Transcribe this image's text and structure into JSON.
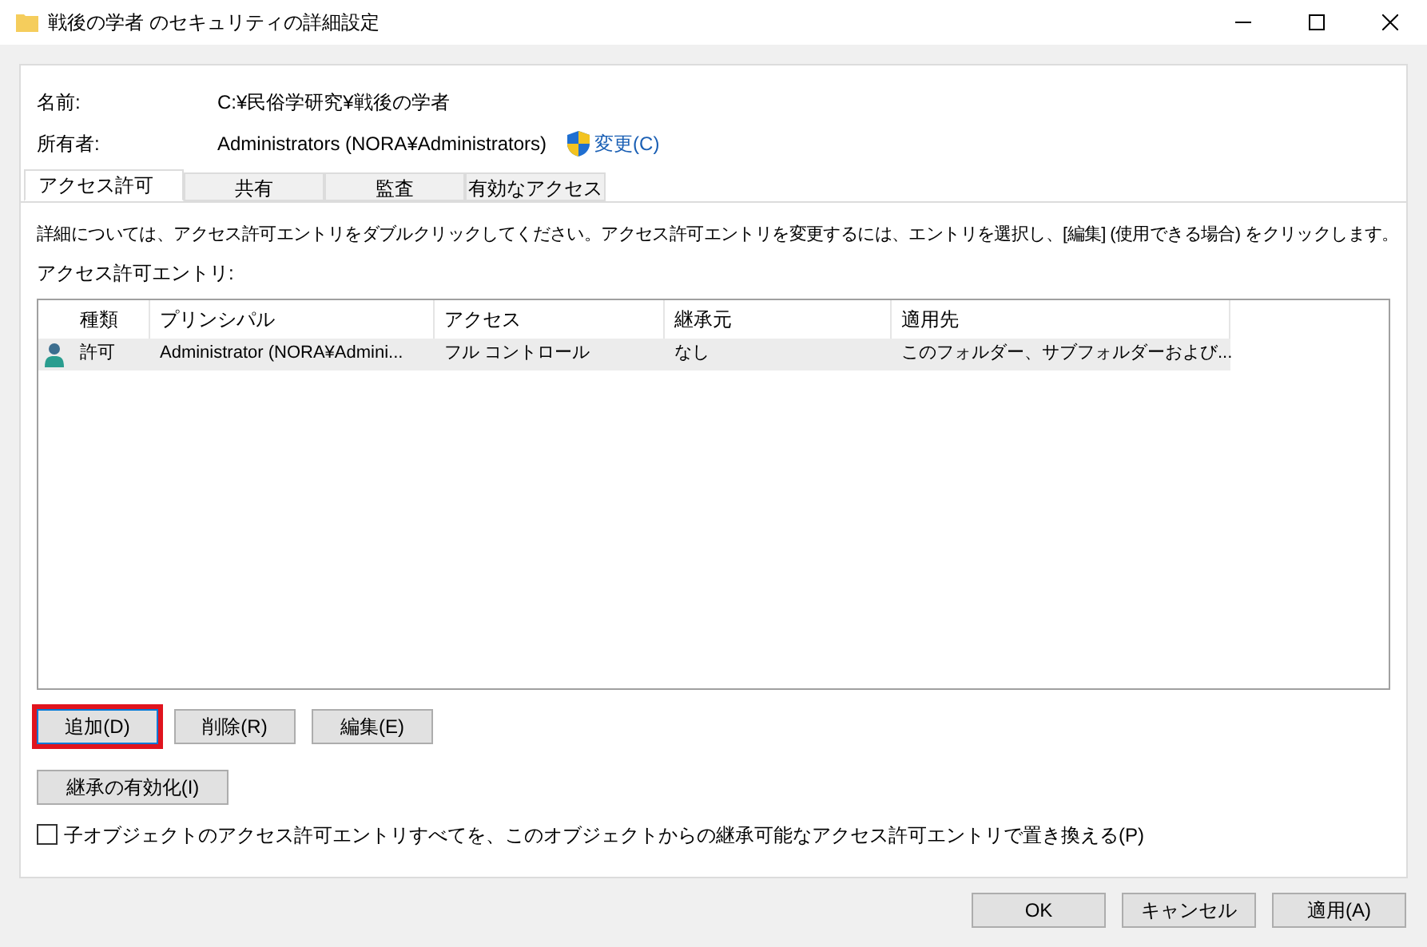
{
  "window": {
    "title": "戦後の学者 のセキュリティの詳細設定"
  },
  "fields": [
    {
      "label": "名前:",
      "value": "C:¥民俗学研究¥戦後の学者"
    },
    {
      "label": "所有者:",
      "value": "Administrators (NORA¥Administrators)",
      "link": "変更(C)"
    }
  ],
  "tabs": [
    {
      "label": "アクセス許可",
      "selected": true
    },
    {
      "label": "共有",
      "selected": false
    },
    {
      "label": "監査",
      "selected": false
    },
    {
      "label": "有効なアクセス",
      "selected": false
    }
  ],
  "info": "詳細については、アクセス許可エントリをダブルクリックしてください。アクセス許可エントリを変更するには、エントリを選択し、[編集] (使用できる場合) をクリックします。",
  "table": {
    "label": "アクセス許可エントリ:",
    "columns": [
      "種類",
      "プリンシパル",
      "アクセス",
      "継承元",
      "適用先"
    ],
    "rows": [
      {
        "cells": [
          "許可",
          "Administrator (NORA¥Admini...",
          "フル コントロール",
          "なし",
          "このフォルダー、サブフォルダーおよび..."
        ],
        "selected": true
      }
    ]
  },
  "entry_buttons": [
    {
      "label": "追加(D)",
      "highlighted": true
    },
    {
      "label": "削除(R)",
      "highlighted": false
    },
    {
      "label": "編集(E)",
      "highlighted": false
    }
  ],
  "inherit_button": "継承の有効化(I)",
  "replace_checkbox": {
    "label": "子オブジェクトのアクセス許可エントリすべてを、このオブジェクトからの継承可能なアクセス許可エントリで置き換える(P)",
    "checked": false
  },
  "dialog_buttons": [
    "OK",
    "キャンセル",
    "適用(A)"
  ]
}
